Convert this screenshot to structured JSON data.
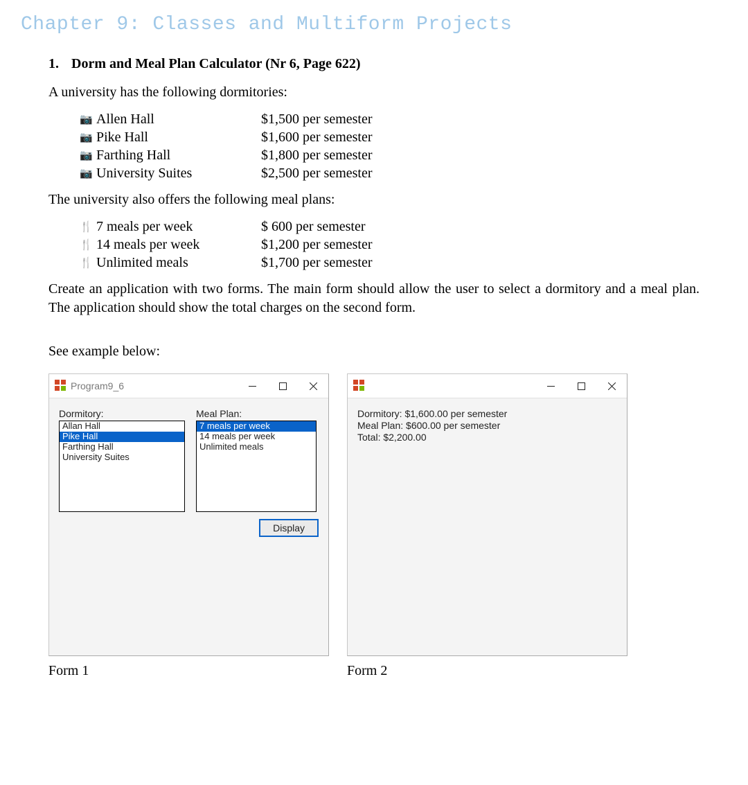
{
  "chapter_title": "Chapter 9: Classes and Multiform Projects",
  "exercise": {
    "number": "1.",
    "title": "Dorm and Meal Plan Calculator (Nr 6, Page 622)"
  },
  "intro_dorms": "A university has the following dormitories:",
  "dorms": [
    {
      "name": "Allen Hall",
      "price": "$1,500 per semester"
    },
    {
      "name": "Pike Hall",
      "price": "$1,600 per semester"
    },
    {
      "name": "Farthing Hall",
      "price": "$1,800 per semester"
    },
    {
      "name": "University Suites",
      "price": "$2,500 per semester"
    }
  ],
  "intro_meals": "The university also offers the following meal plans:",
  "meals": [
    {
      "name": "7 meals per week",
      "price": "$ 600 per semester"
    },
    {
      "name": " 14 meals per week",
      "price": "$1,200 per semester"
    },
    {
      "name": " Unlimited meals",
      "price": "$1,700 per semester"
    }
  ],
  "instruction": "Create an application with two forms.  The main form should allow the user to select a dormitory and a meal plan.  The application should show the total charges on the second form.",
  "see_example": "See example below:",
  "form1": {
    "title": "Program9_6",
    "dorm_label": "Dormitory:",
    "meal_label": "Meal Plan:",
    "dorm_items": [
      "Allan Hall",
      "Pike Hall",
      "Farthing Hall",
      "University Suites"
    ],
    "dorm_selected_index": 1,
    "meal_items": [
      "7 meals per week",
      "14 meals per week",
      "Unlimited meals"
    ],
    "meal_selected_index": 0,
    "display_button": "Display",
    "caption": "Form 1"
  },
  "form2": {
    "title": "",
    "lines": [
      "Dormitory: $1,600.00 per semester",
      "Meal Plan: $600.00 per semester",
      "Total: $2,200.00"
    ],
    "caption": "Form 2"
  }
}
